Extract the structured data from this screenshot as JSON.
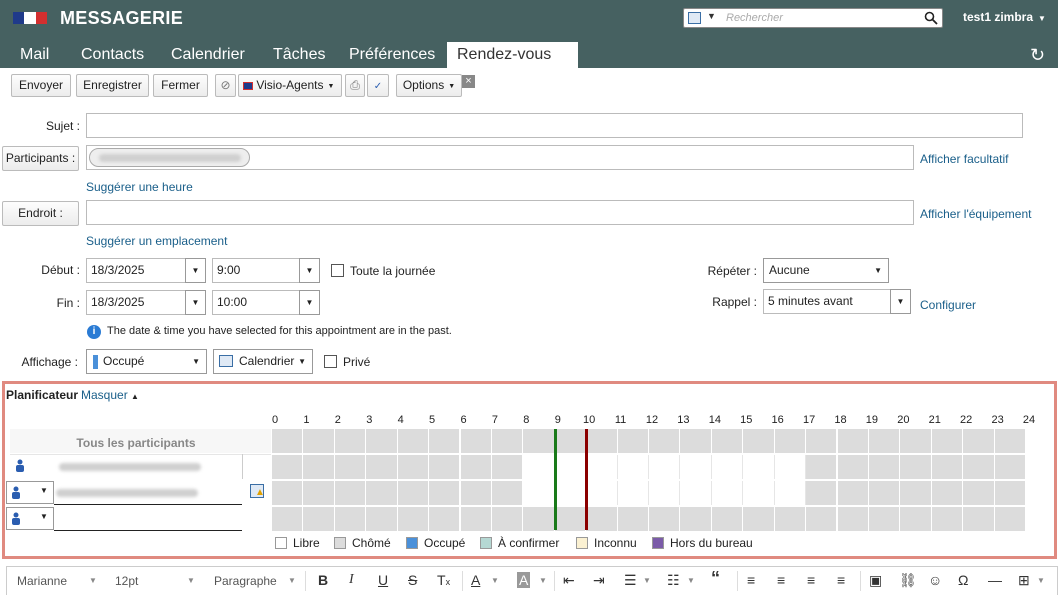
{
  "header": {
    "app_title": "MESSAGERIE",
    "search_placeholder": "Rechercher",
    "user_name": "test1 zimbra"
  },
  "tabs": [
    {
      "label": "Mail"
    },
    {
      "label": "Contacts"
    },
    {
      "label": "Calendrier"
    },
    {
      "label": "Tâches"
    },
    {
      "label": "Préférences"
    },
    {
      "label": "Rendez-vous"
    }
  ],
  "toolbar": {
    "send": "Envoyer",
    "save": "Enregistrer",
    "close": "Fermer",
    "visio": "Visio-Agents",
    "options": "Options"
  },
  "form": {
    "subject_label": "Sujet :",
    "subject_value": "",
    "participants_label": "Participants :",
    "show_optional": "Afficher facultatif",
    "suggest_time": "Suggérer une heure",
    "location_label": "Endroit :",
    "location_value": "",
    "show_equipment": "Afficher l'équipement",
    "suggest_location": "Suggérer un emplacement",
    "start_label": "Début :",
    "start_date": "18/3/2025",
    "start_time": "9:00",
    "all_day": "Toute la journée",
    "end_label": "Fin :",
    "end_date": "18/3/2025",
    "end_time": "10:00",
    "repeat_label": "Répéter :",
    "repeat_value": "Aucune",
    "reminder_label": "Rappel :",
    "reminder_value": "5 minutes avant",
    "configure": "Configurer",
    "past_notice": "The date & time you have selected for this appointment are in the past.",
    "display_label": "Affichage :",
    "display_value": "Occupé",
    "calendar_value": "Calendrier",
    "private_label": "Privé"
  },
  "scheduler": {
    "title": "Planificateur",
    "hide": "Masquer",
    "all_participants": "Tous les participants",
    "hours": [
      "0",
      "1",
      "2",
      "3",
      "4",
      "5",
      "6",
      "7",
      "8",
      "9",
      "10",
      "11",
      "12",
      "13",
      "14",
      "15",
      "16",
      "17",
      "18",
      "19",
      "20",
      "21",
      "22",
      "23",
      "24"
    ],
    "legend": [
      {
        "label": "Libre",
        "color": "#ffffff"
      },
      {
        "label": "Chômé",
        "color": "#dcdcdc"
      },
      {
        "label": "Occupé",
        "color": "#4a90d9"
      },
      {
        "label": "À confirmer",
        "color": "#b5d8d3"
      },
      {
        "label": "Inconnu",
        "color": "#fbf1d2"
      },
      {
        "label": "Hors du bureau",
        "color": "#7b5ba8"
      }
    ]
  },
  "editor": {
    "font": "Marianne",
    "size": "12pt",
    "block": "Paragraphe"
  },
  "colors": {
    "header_bg": "#466161",
    "link": "#1a5f8a",
    "scheduler_border": "#e08a80",
    "start_line": "#1a7a1a",
    "end_line": "#8b0000"
  }
}
